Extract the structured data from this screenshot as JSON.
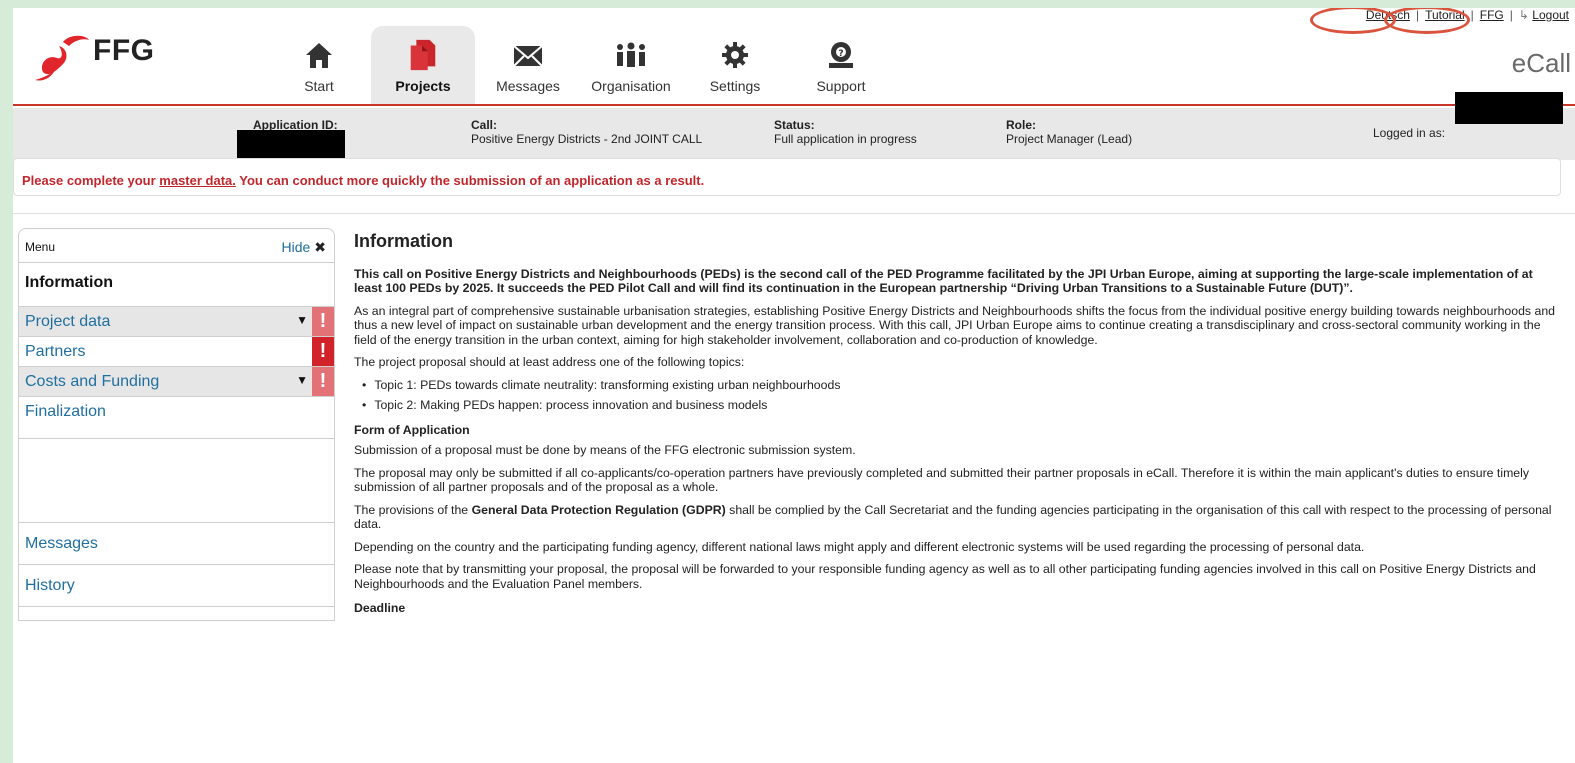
{
  "brand": {
    "logo_text": "FFG",
    "app_name": "eCall"
  },
  "top_links": {
    "german": "Deutsch",
    "tutorial": "Tutorial",
    "ffg": "FFG",
    "logout": "Logout"
  },
  "nav": [
    {
      "label": "Start",
      "icon": "home-icon"
    },
    {
      "label": "Projects",
      "icon": "projects-icon",
      "active": true
    },
    {
      "label": "Messages",
      "icon": "envelope-icon"
    },
    {
      "label": "Organisation",
      "icon": "people-icon"
    },
    {
      "label": "Settings",
      "icon": "gear-icon"
    },
    {
      "label": "Support",
      "icon": "support-icon"
    }
  ],
  "infobar": {
    "app_id_label": "Application ID:",
    "call_label": "Call:",
    "call_value": "Positive Energy Districts - 2nd JOINT CALL",
    "status_label": "Status:",
    "status_value": "Full application in progress",
    "role_label": "Role:",
    "role_value": "Project Manager (Lead)",
    "logged_in_label": "Logged in as:"
  },
  "alert": {
    "prefix": "Please complete your ",
    "link": "master data.",
    "suffix": " You can conduct more quickly the submission of an application as a result."
  },
  "sidebar": {
    "menu_label": "Menu",
    "hide_label": "Hide",
    "items": [
      {
        "label": "Information"
      },
      {
        "label": "Project data"
      },
      {
        "label": "Partners"
      },
      {
        "label": "Costs and Funding"
      },
      {
        "label": "Finalization"
      },
      {
        "label": "Messages"
      },
      {
        "label": "History"
      }
    ],
    "warn_glyph": "!"
  },
  "content": {
    "title": "Information",
    "lead": "This call on Positive Energy Districts and Neighbourhoods (PEDs) is the second call of the PED Programme facilitated by the JPI Urban Europe, aiming at supporting the large-scale implementation of at least 100 PEDs by 2025. It succeeds the PED Pilot Call and will find its continuation in the European partnership “Driving Urban Transitions to a Sustainable Future (DUT)”.",
    "p1": "As an integral part of comprehensive sustainable urbanisation strategies, establishing Positive Energy Districts and Neighbourhoods shifts the focus from the individual positive energy building towards neighbourhoods and thus a new level of impact on sustainable urban development and the energy transition process. With this call, JPI Urban Europe aims to continue creating a transdisciplinary and cross-sectoral community working in the field of the energy transition in the urban context, aiming for high stakeholder involvement, collaboration and co-production of knowledge.",
    "p2": "The project proposal should at least address one of the following topics:",
    "topics": [
      "Topic 1: PEDs towards climate neutrality: transforming existing urban neighbourhoods",
      "Topic 2: Making PEDs happen: process innovation and business models"
    ],
    "h_form": "Form of Application",
    "p3": "Submission of a proposal must be done by means of the FFG electronic submission system.",
    "p4": "The proposal may only be submitted if all co-applicants/co-operation partners have previously completed and submitted their partner proposals in eCall. Therefore it is within the main applicant's duties to ensure timely submission of all partner proposals and of the proposal as a whole.",
    "p5_a": "The provisions of the ",
    "p5_b": "General Data Protection Regulation (GDPR)",
    "p5_c": " shall be complied by the Call Secretariat and the funding agencies participating in the organisation of this call with respect to the processing of personal data.",
    "p6": "Depending on the country and the participating funding agency, different national laws might apply and different electronic systems will be used regarding the processing of personal data.",
    "p7": "Please note that by transmitting your proposal, the proposal will be forwarded to your responsible funding agency as well as to all other participating funding agencies involved in this call on Positive Energy Districts and Neighbourhoods and the Evaluation Panel members.",
    "h_deadline": "Deadline"
  },
  "colors": {
    "accent": "#c9352a",
    "warn": "#d2232a",
    "warn_light": "#e27276",
    "link": "#1f6fa0",
    "alert_text": "#c0272d",
    "annotation": "#d9533d"
  }
}
